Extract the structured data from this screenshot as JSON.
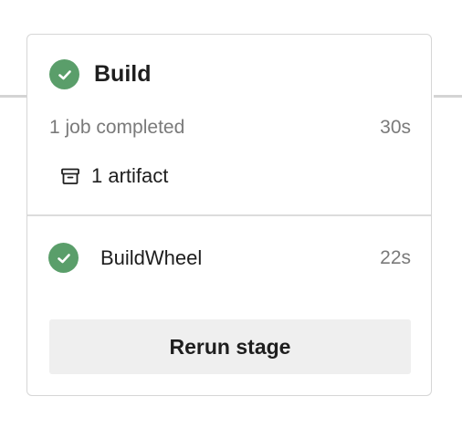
{
  "stage": {
    "title": "Build",
    "status_icon": "check-circle-icon",
    "status_color": "#5a9e6a",
    "summary": "1 job completed",
    "duration": "30s",
    "artifact_icon": "archive-icon",
    "artifact_label": "1 artifact"
  },
  "jobs": [
    {
      "name": "BuildWheel",
      "duration": "22s",
      "status_icon": "check-circle-icon"
    }
  ],
  "actions": {
    "rerun_label": "Rerun stage"
  }
}
